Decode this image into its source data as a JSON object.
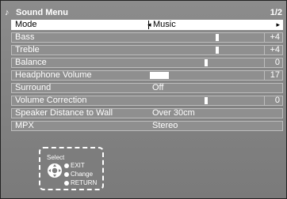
{
  "menu": {
    "title": "Sound Menu",
    "page": "1/2"
  },
  "rows": [
    {
      "label": "Mode",
      "value": "Music",
      "selected": true
    },
    {
      "label": "Bass",
      "number": "+4",
      "level": 0.6
    },
    {
      "label": "Treble",
      "number": "+4",
      "level": 0.6
    },
    {
      "label": "Balance",
      "number": "0",
      "level": 0.5
    },
    {
      "label": "Headphone Volume",
      "number": "17",
      "fill": 0.17
    },
    {
      "label": "Surround",
      "value": "Off"
    },
    {
      "label": "Volume Correction",
      "number": "0",
      "level": 0.5
    },
    {
      "label": "Speaker Distance to Wall",
      "value": "Over 30cm"
    },
    {
      "label": "MPX",
      "value": "Stereo"
    }
  ],
  "help": {
    "select": "Select",
    "exit": "EXIT",
    "change": "Change",
    "return": "RETURN"
  },
  "icons": {
    "title": "music-note-icon",
    "dpad": "dpad-icon"
  }
}
